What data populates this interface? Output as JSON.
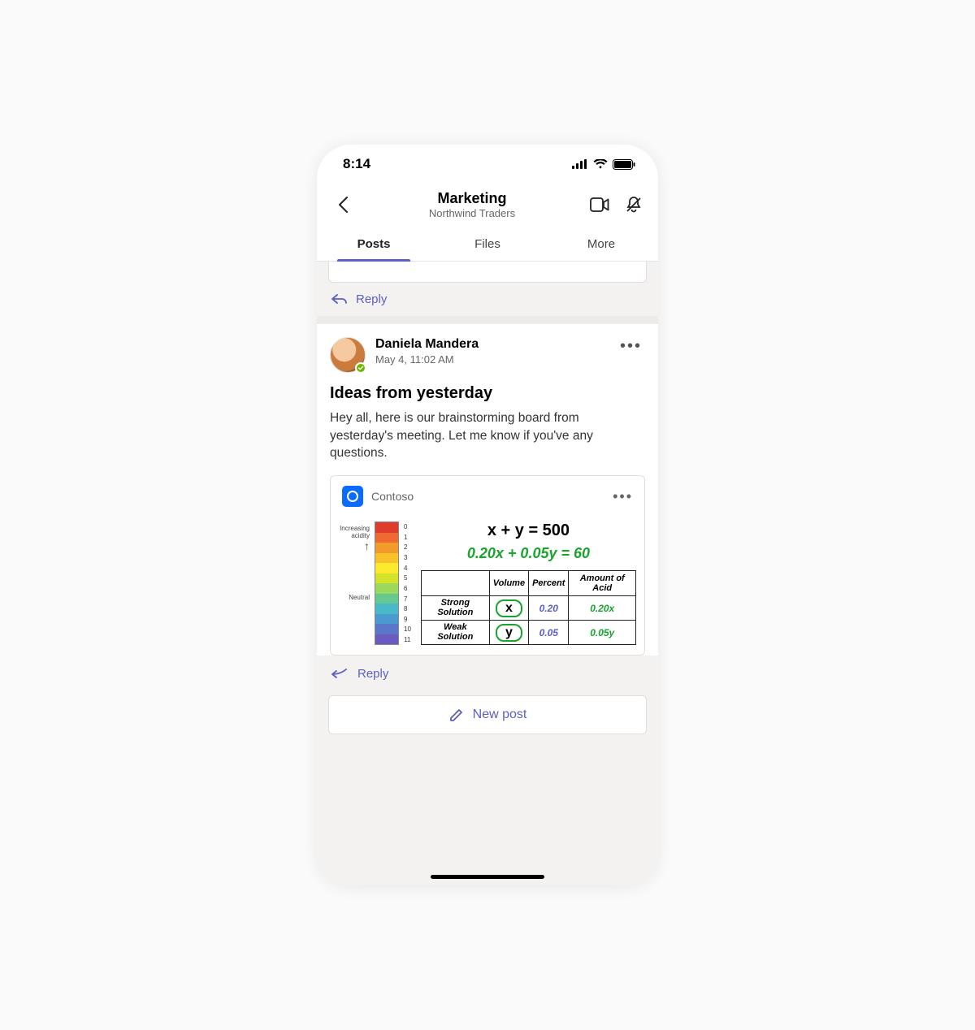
{
  "statusbar": {
    "time": "8:14"
  },
  "nav": {
    "title": "Marketing",
    "subtitle": "Northwind Traders"
  },
  "tabs": [
    {
      "label": "Posts",
      "active": true
    },
    {
      "label": "Files",
      "active": false
    },
    {
      "label": "More",
      "active": false
    }
  ],
  "reply_label": "Reply",
  "post": {
    "author": "Daniela Mandera",
    "timestamp": "May 4, 11:02 AM",
    "title": "Ideas from yesterday",
    "body": "Hey all, here is our brainstorming board from yesterday's meeting. Let me know if you've any questions."
  },
  "card": {
    "app_name": "Contoso"
  },
  "whiteboard": {
    "ph_increasing": "Increasing acidity",
    "ph_neutral": "Neutral",
    "ph_ticks": [
      "0",
      "1",
      "2",
      "3",
      "4",
      "5",
      "6",
      "7",
      "8",
      "9",
      "10",
      "11"
    ],
    "ph_colors": [
      "#e03c2e",
      "#ee6a32",
      "#f39a2c",
      "#f8c22b",
      "#fdea2c",
      "#d4e22a",
      "#9bd85c",
      "#66c98f",
      "#49b8c8",
      "#4a99cf",
      "#5a77c9",
      "#6b5bc1"
    ],
    "eq1": "x + y = 500",
    "eq2": "0.20x + 0.05y = 60",
    "table": {
      "headers": [
        "",
        "Volume",
        "Percent",
        "Amount of Acid"
      ],
      "rows": [
        {
          "label": "Strong Solution",
          "vol": "x",
          "pct": "0.20",
          "amt": "0.20x"
        },
        {
          "label": "Weak Solution",
          "vol": "y",
          "pct": "0.05",
          "amt": "0.05y"
        }
      ]
    }
  },
  "newpost_label": "New post"
}
